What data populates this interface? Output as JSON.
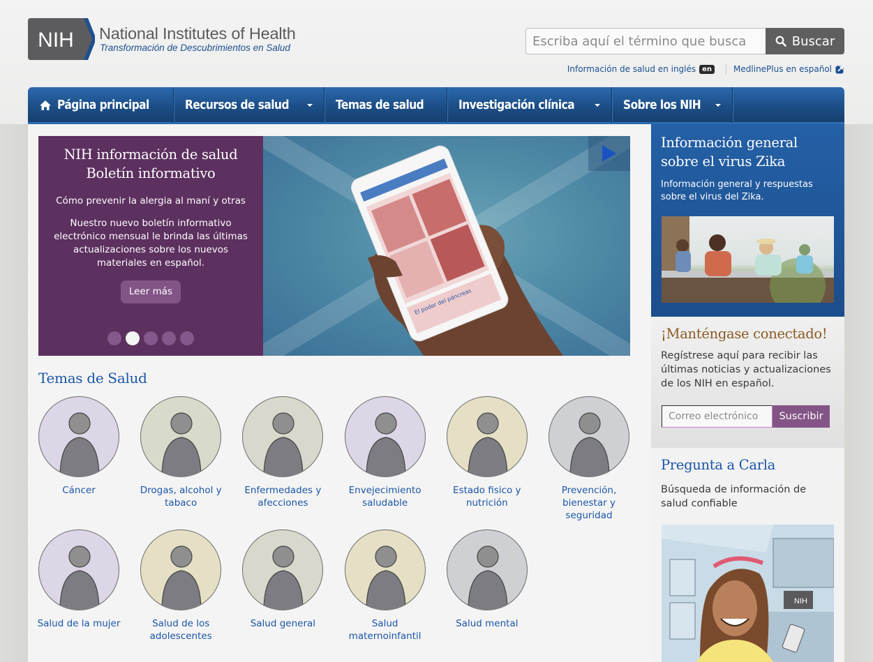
{
  "header": {
    "logo": {
      "mark": "NIH",
      "title": "National Institutes of Health",
      "subtitle": "Transformación de Descubrimientos en Salud"
    },
    "search": {
      "placeholder": "Escriba aquí el término que busca",
      "value": "",
      "button_label": "Buscar",
      "icon": "search-icon"
    },
    "util_links": [
      {
        "label": "Información de salud en inglés",
        "badge": "en"
      },
      {
        "label": "MedlinePlus en español",
        "icon": "external-link-icon"
      }
    ]
  },
  "nav": {
    "items": [
      {
        "label": "Página principal",
        "icon": "home-icon",
        "dropdown": false
      },
      {
        "label": "Recursos de salud",
        "dropdown": true
      },
      {
        "label": "Temas de salud",
        "dropdown": false
      },
      {
        "label": "Investigación clínica",
        "dropdown": true
      },
      {
        "label": "Sobre los NIH",
        "dropdown": true
      }
    ]
  },
  "carousel": {
    "title": "NIH información de salud Boletín informativo",
    "subtitle": "Cómo prevenir la alergia al maní y otras",
    "body": "Nuestro nuevo boletín informativo electrónico mensual le brinda las últimas actualizaciones sobre los nuevos materiales en español.",
    "button_label": "Leer más",
    "slide_count": 5,
    "active_slide": 2,
    "image_alt": "Mano sosteniendo un teléfono con el boletín NIH información de salud",
    "play_icon": "play-icon"
  },
  "topics": {
    "title": "Temas de Salud",
    "items": [
      {
        "label": "Cáncer",
        "bg": "#dcd6e6"
      },
      {
        "label": "Drogas, alcohol y tabaco",
        "bg": "#d8dacb"
      },
      {
        "label": "Enfermedades y afecciones",
        "bg": "#d8d9cc"
      },
      {
        "label": "Envejecimiento saludable",
        "bg": "#dcd6e6"
      },
      {
        "label": "Estado fisico y nutrición",
        "bg": "#e5e0c5"
      },
      {
        "label": "Prevención, bienestar y seguridad",
        "bg": "#cfd0d3"
      },
      {
        "label": "Salud de la mujer",
        "bg": "#dcd6e6"
      },
      {
        "label": "Salud de los adolescentes",
        "bg": "#e5e0c5"
      },
      {
        "label": "Salud general",
        "bg": "#d8d9cc"
      },
      {
        "label": "Salud maternoinfantil",
        "bg": "#e5e0c5"
      },
      {
        "label": "Salud mental",
        "bg": "#cfd0d3"
      }
    ]
  },
  "sidebar": {
    "zika": {
      "title": "Información general sobre el virus Zika",
      "text": "Información general y respuestas sobre el virus del Zika."
    },
    "connect": {
      "title": "¡Manténgase conectado!",
      "text": "Regístrese aquí para recibir las últimas noticias y actualizaciones de los NIH en español.",
      "email_placeholder": "Correo electrónico",
      "email_value": "",
      "button_label": "Suscribir"
    },
    "carla": {
      "title": "Pregunta a Carla",
      "text": "Búsqueda de información de salud confiable"
    }
  },
  "colors": {
    "brand_blue": "#1a56a8",
    "nav_blue": "#1c4e86",
    "purple": "#5c305f",
    "purple_button": "#835486",
    "connect_title": "#8a5a22"
  }
}
